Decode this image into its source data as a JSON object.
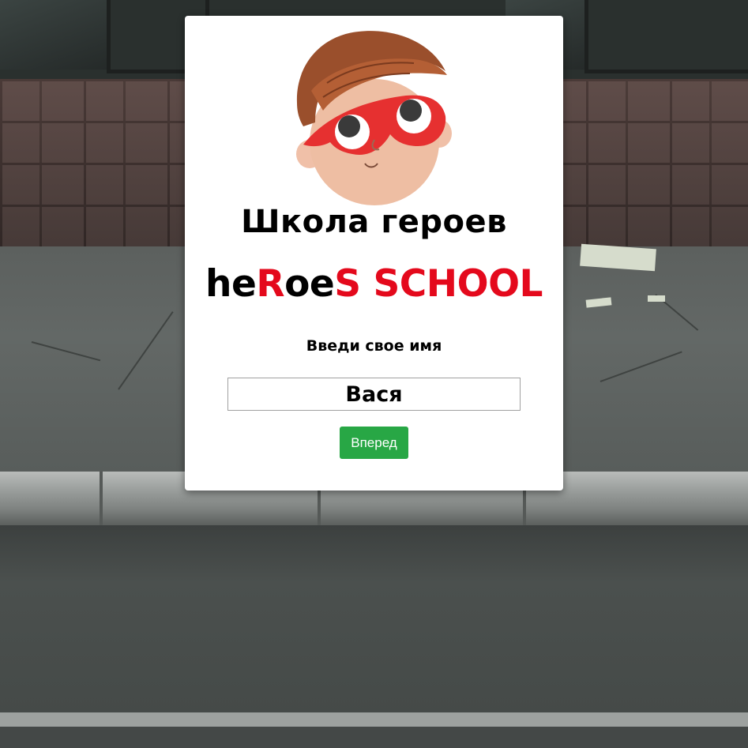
{
  "card": {
    "title_ru": "Школа героев",
    "title_en_parts": [
      {
        "text": "he",
        "color": "#000000"
      },
      {
        "text": "R",
        "color": "#e4091c"
      },
      {
        "text": "oe",
        "color": "#000000"
      },
      {
        "text": "S SCHOOL",
        "color": "#e4091c"
      }
    ],
    "name_label": "Введи свое имя",
    "name_value": "Вася",
    "go_button_label": "Вперед"
  },
  "colors": {
    "accent_red": "#e4091c",
    "button_green": "#28a745"
  },
  "icons": {
    "avatar": "superhero-boy-mask-icon"
  }
}
